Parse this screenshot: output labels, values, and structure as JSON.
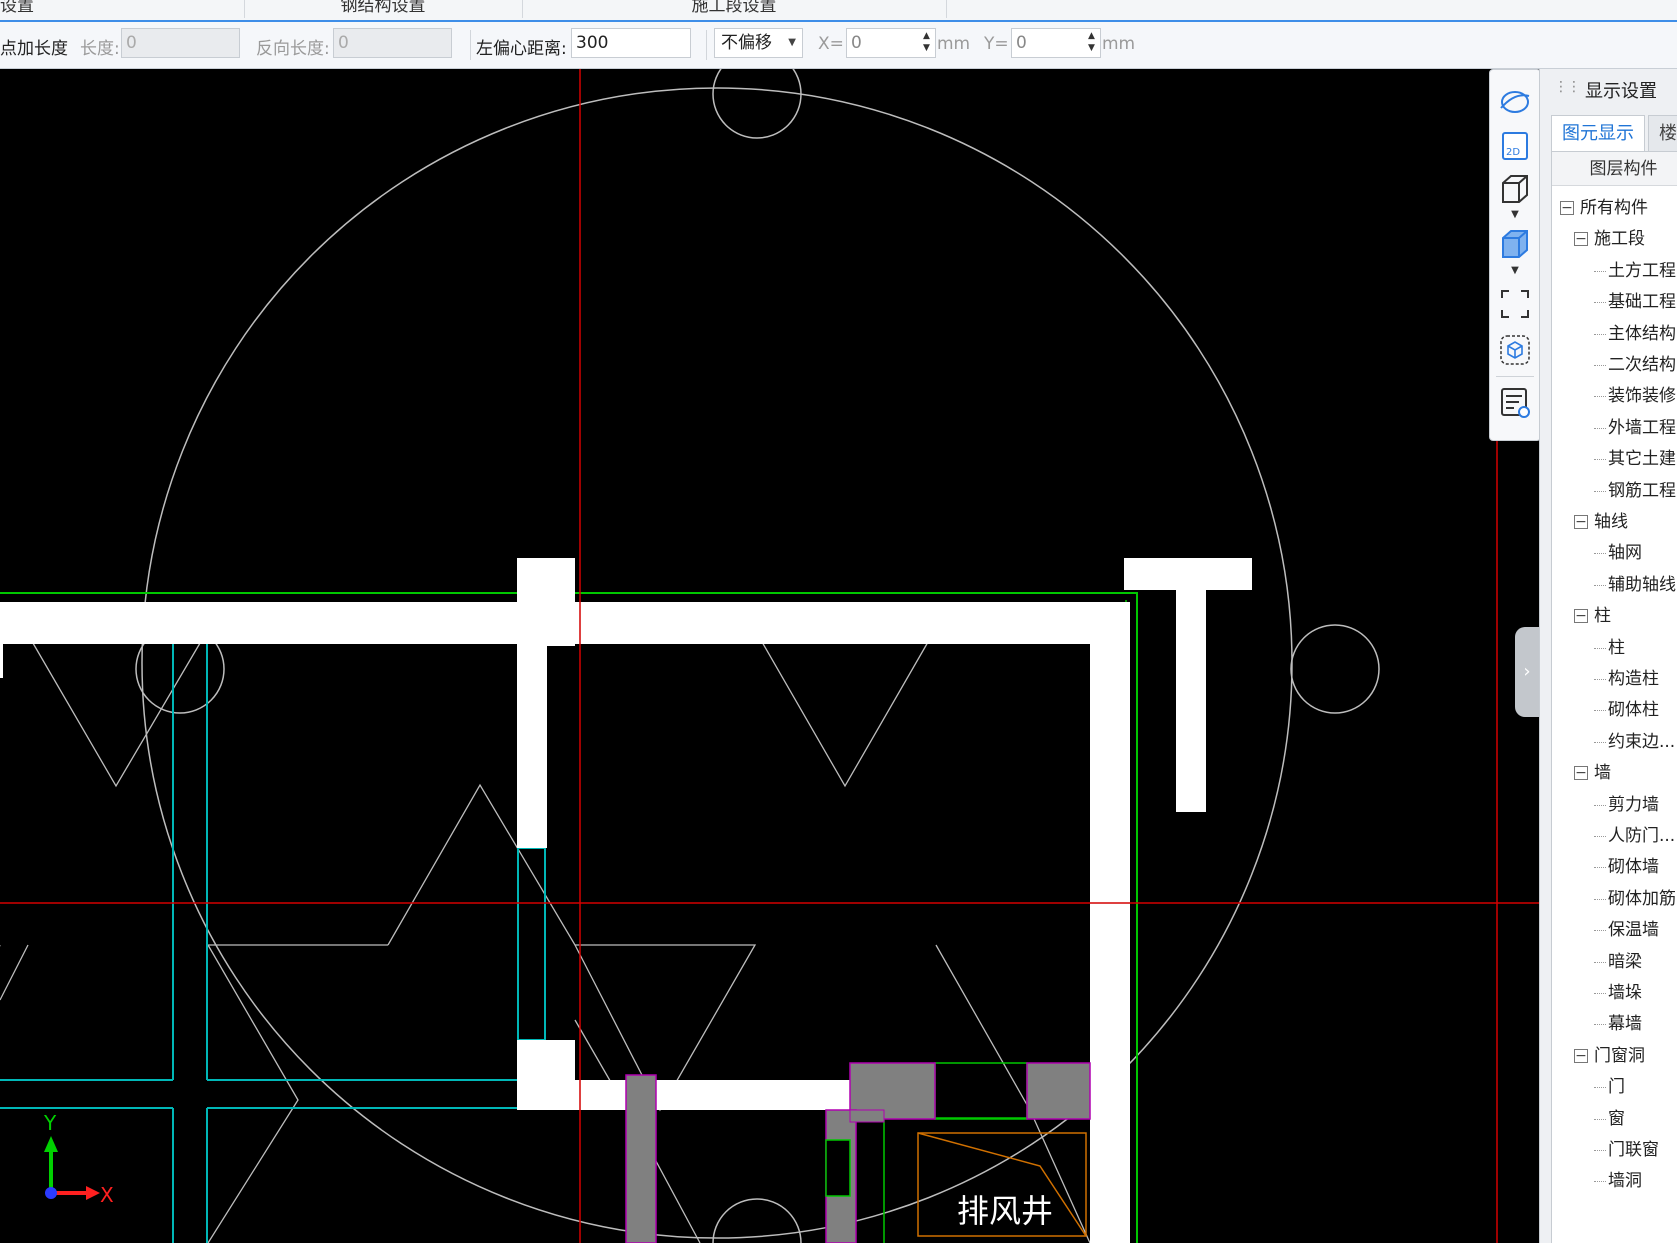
{
  "top_tabs": [
    "设置",
    "钢结构设置",
    "施工段设置"
  ],
  "toolbar": {
    "extra_length_label": "点加长度",
    "length_label": "长度:",
    "length_value": "0",
    "reverse_length_label": "反向长度:",
    "reverse_length_value": "0",
    "left_offset_label": "左偏心距离:",
    "left_offset_value": "300",
    "offset_mode": "不偏移",
    "x_label": "X=",
    "x_value": "0",
    "x_unit": "mm",
    "y_label": "Y=",
    "y_value": "0",
    "y_unit": "mm"
  },
  "canvas": {
    "room_label": "排风井",
    "axis_x_label": "X",
    "axis_y_label": "Y",
    "colors": {
      "background": "#000000",
      "wall": "#ffffff",
      "crosshair": "#d40000",
      "boundary": "#00c800",
      "cyan_outline": "#00b7b7",
      "magenta_outline": "#b000b0",
      "gray_fill": "#808080",
      "orange_outline": "#d07000"
    }
  },
  "view_toolbar": {
    "buttons": [
      "orbit-icon",
      "2d-view-icon",
      "3d-box-icon",
      "3d-solid-icon",
      "fit-view-icon",
      "local-3d-icon",
      "display-settings-icon"
    ]
  },
  "panel": {
    "title": "显示设置",
    "tabs": [
      "图元显示",
      "楼"
    ],
    "tree_header": "图层构件",
    "tree": [
      {
        "label": "所有构件",
        "level": 0,
        "expander": true
      },
      {
        "label": "施工段",
        "level": 1,
        "expander": true
      },
      {
        "label": "土方工程",
        "level": 2
      },
      {
        "label": "基础工程",
        "level": 2
      },
      {
        "label": "主体结构",
        "level": 2
      },
      {
        "label": "二次结构",
        "level": 2
      },
      {
        "label": "装饰装修",
        "level": 2
      },
      {
        "label": "外墙工程",
        "level": 2
      },
      {
        "label": "其它土建",
        "level": 2
      },
      {
        "label": "钢筋工程",
        "level": 2
      },
      {
        "label": "轴线",
        "level": 1,
        "expander": true
      },
      {
        "label": "轴网",
        "level": 2
      },
      {
        "label": "辅助轴线",
        "level": 2
      },
      {
        "label": "柱",
        "level": 1,
        "expander": true
      },
      {
        "label": "柱",
        "level": 2
      },
      {
        "label": "构造柱",
        "level": 2
      },
      {
        "label": "砌体柱",
        "level": 2
      },
      {
        "label": "约束边...",
        "level": 2
      },
      {
        "label": "墙",
        "level": 1,
        "expander": true
      },
      {
        "label": "剪力墙",
        "level": 2
      },
      {
        "label": "人防门...",
        "level": 2
      },
      {
        "label": "砌体墙",
        "level": 2
      },
      {
        "label": "砌体加筋",
        "level": 2
      },
      {
        "label": "保温墙",
        "level": 2
      },
      {
        "label": "暗梁",
        "level": 2
      },
      {
        "label": "墙垛",
        "level": 2
      },
      {
        "label": "幕墙",
        "level": 2
      },
      {
        "label": "门窗洞",
        "level": 1,
        "expander": true
      },
      {
        "label": "门",
        "level": 2
      },
      {
        "label": "窗",
        "level": 2
      },
      {
        "label": "门联窗",
        "level": 2
      },
      {
        "label": "墙洞",
        "level": 2
      }
    ]
  }
}
